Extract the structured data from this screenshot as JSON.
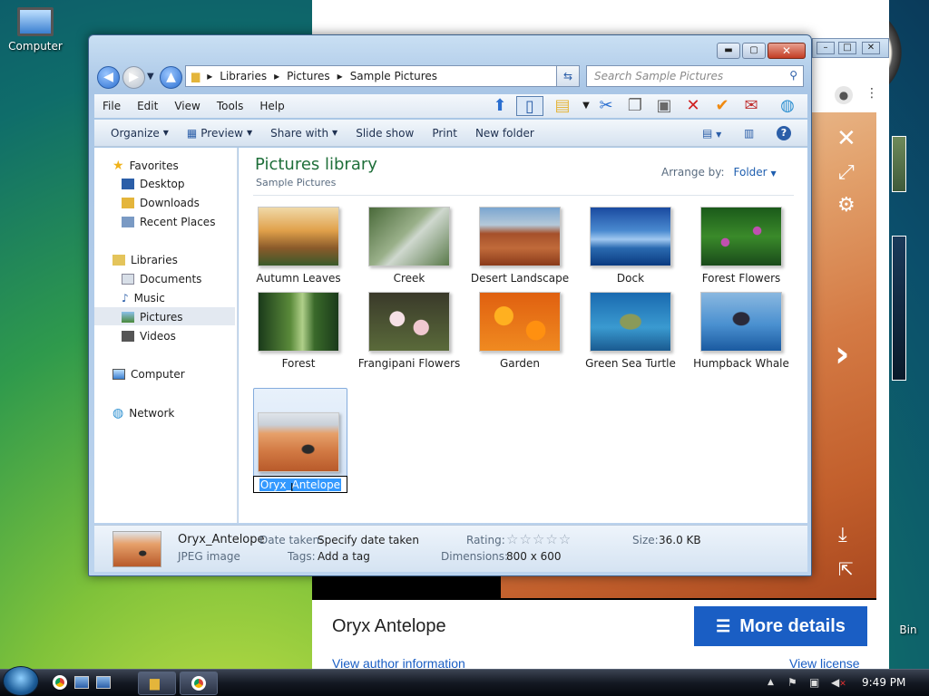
{
  "desktop": {
    "computer_label": "Computer",
    "recycle_label": "Bin"
  },
  "browser": {
    "image_title": "Oryx Antelope",
    "more_details": "More details",
    "author_link": "View author information",
    "license_link": "View license"
  },
  "window": {
    "breadcrumb": [
      "Libraries",
      "Pictures",
      "Sample Pictures"
    ],
    "search_placeholder": "Search Sample Pictures",
    "menu": [
      "File",
      "Edit",
      "View",
      "Tools",
      "Help"
    ],
    "commands": {
      "organize": "Organize",
      "preview": "Preview",
      "share": "Share with",
      "slideshow": "Slide show",
      "print": "Print",
      "new_folder": "New folder"
    },
    "nav": {
      "favorites": "Favorites",
      "desktop": "Desktop",
      "downloads": "Downloads",
      "recent": "Recent Places",
      "libraries": "Libraries",
      "documents": "Documents",
      "music": "Music",
      "pictures": "Pictures",
      "videos": "Videos",
      "computer": "Computer",
      "network": "Network"
    },
    "library_title": "Pictures library",
    "library_sub": "Sample Pictures",
    "arrange_label": "Arrange by:",
    "arrange_value": "Folder",
    "files": [
      "Autumn Leaves",
      "Creek",
      "Desert Landscape",
      "Dock",
      "Forest Flowers",
      "Forest",
      "Frangipani Flowers",
      "Garden",
      "Green Sea Turtle",
      "Humpback Whale"
    ],
    "rename_value": "Oryx_Antelope",
    "details": {
      "name": "Oryx_Antelope",
      "type": "JPEG image",
      "date_label": "Date taken:",
      "date_value": "Specify date taken",
      "tags_label": "Tags:",
      "tags_value": "Add a tag",
      "rating_label": "Rating:",
      "rating_stars": "☆☆☆☆☆",
      "dim_label": "Dimensions:",
      "dim_value": "800 x 600",
      "size_label": "Size:",
      "size_value": "36.0 KB"
    }
  },
  "taskbar": {
    "time": "9:49 PM"
  }
}
